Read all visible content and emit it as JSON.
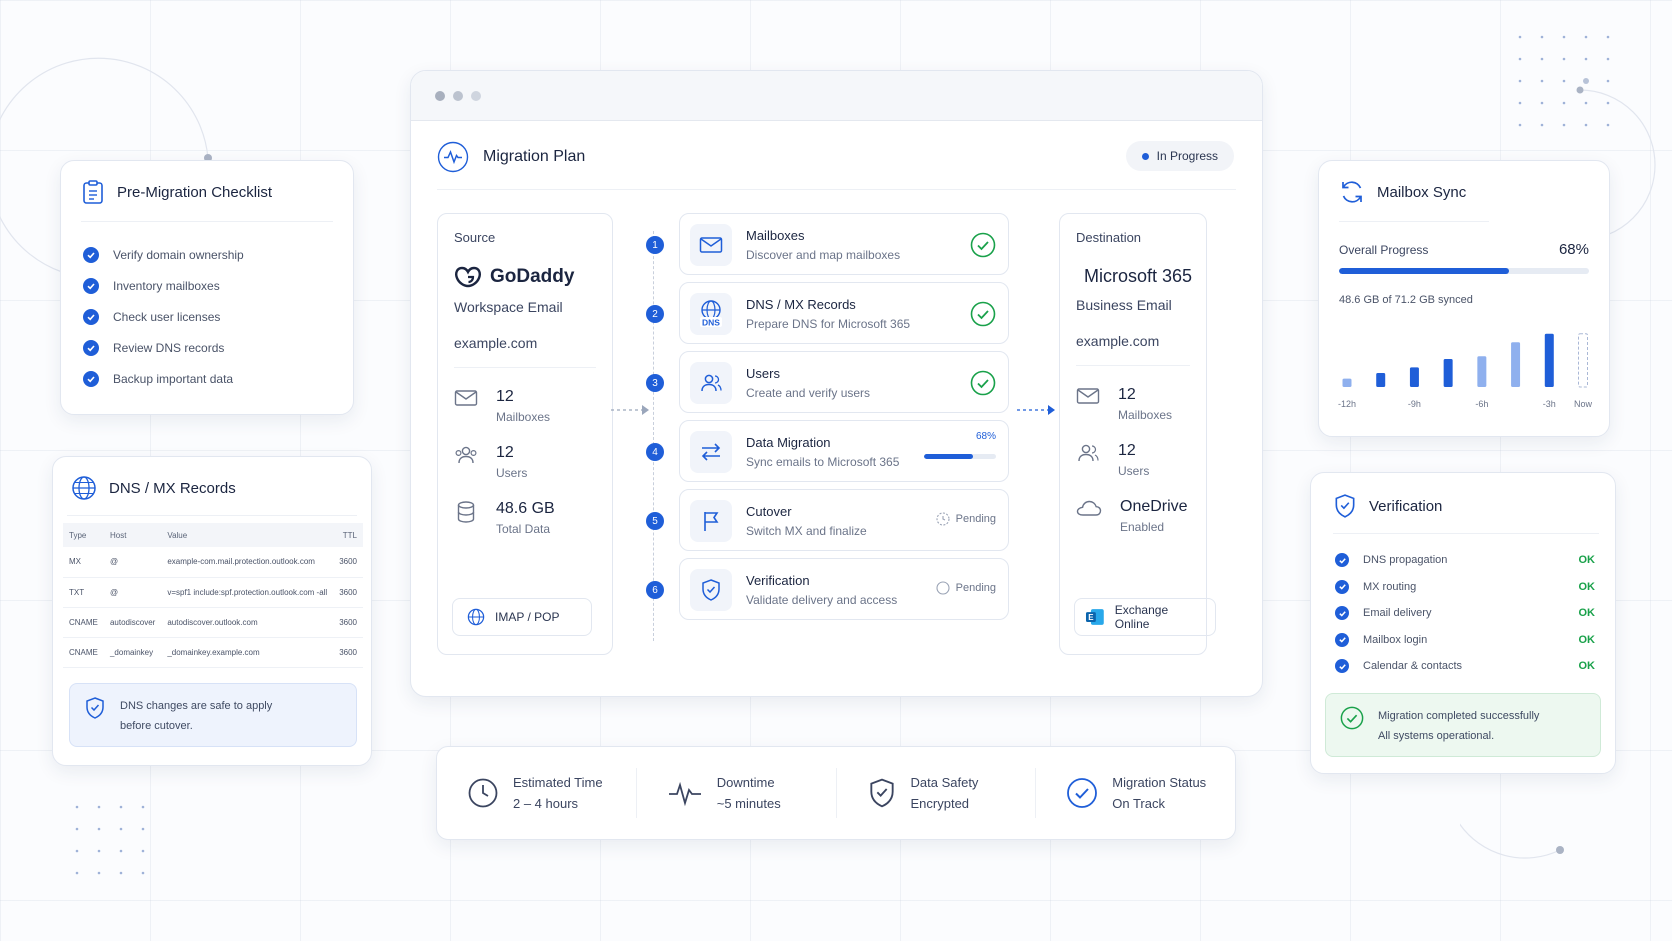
{
  "checklist": {
    "title": "Pre-Migration Checklist",
    "items": [
      "Verify domain ownership",
      "Inventory mailboxes",
      "Check user licenses",
      "Review DNS records",
      "Backup important data"
    ]
  },
  "dns": {
    "title": "DNS / MX Records",
    "columns": [
      "Type",
      "Host",
      "Value",
      "TTL"
    ],
    "rows": [
      [
        "MX",
        "@",
        "example-com.mail.protection.outlook.com",
        "3600"
      ],
      [
        "TXT",
        "@",
        "v=spf1 include:spf.protection.outlook.com -all",
        "3600"
      ],
      [
        "CNAME",
        "autodiscover",
        "autodiscover.outlook.com",
        "3600"
      ],
      [
        "CNAME",
        "_domainkey",
        "_domainkey.example.com",
        "3600"
      ]
    ],
    "note_line1": "DNS changes are safe to apply",
    "note_line2": "before cutover."
  },
  "plan": {
    "title": "Migration Plan",
    "status": "In Progress",
    "source": {
      "label": "Source",
      "brand": "GoDaddy",
      "product": "Workspace Email",
      "domain": "example.com",
      "stats": [
        {
          "value": "12",
          "caption": "Mailboxes"
        },
        {
          "value": "12",
          "caption": "Users"
        },
        {
          "value": "48.6 GB",
          "caption": "Total Data"
        }
      ],
      "protocol": "IMAP / POP"
    },
    "destination": {
      "label": "Destination",
      "brand": "Microsoft 365",
      "product": "Business Email",
      "domain": "example.com",
      "stats": [
        {
          "value": "12",
          "caption": "Mailboxes"
        },
        {
          "value": "12",
          "caption": "Users"
        },
        {
          "value": "OneDrive",
          "caption": "Enabled"
        }
      ],
      "service": "Exchange Online"
    },
    "steps": [
      {
        "n": "1",
        "title": "Mailboxes",
        "desc": "Discover and map mailboxes",
        "state": "done"
      },
      {
        "n": "2",
        "title": "DNS / MX Records",
        "desc": "Prepare DNS for Microsoft 365",
        "state": "done"
      },
      {
        "n": "3",
        "title": "Users",
        "desc": "Create and verify users",
        "state": "done"
      },
      {
        "n": "4",
        "title": "Data Migration",
        "desc": "Sync emails to Microsoft 365",
        "state": "progress",
        "progress_label": "68%",
        "progress": 0.68
      },
      {
        "n": "5",
        "title": "Cutover",
        "desc": "Switch MX and finalize",
        "state": "pending",
        "state_label": "Pending"
      },
      {
        "n": "6",
        "title": "Verification",
        "desc": "Validate delivery and access",
        "state": "pending",
        "state_label": "Pending"
      }
    ],
    "dns_icon_text": "DNS"
  },
  "summary": [
    {
      "label": "Estimated Time",
      "value": "2 – 4 hours"
    },
    {
      "label": "Downtime",
      "value": "~5 minutes"
    },
    {
      "label": "Data Safety",
      "value": "Encrypted"
    },
    {
      "label": "Migration Status",
      "value": "On Track"
    }
  ],
  "sync": {
    "title": "Mailbox Sync",
    "progress_label": "Overall Progress",
    "progress_pct": "68%",
    "progress": 0.68,
    "synced": "48.6 GB of 71.2 GB synced",
    "chart_data": {
      "type": "bar",
      "categories": [
        "-12h",
        "-9h",
        "-6h",
        "-3h",
        "Now"
      ],
      "x_ticks": [
        "-12h",
        "-9h",
        "-6h",
        "-3h",
        "Now"
      ],
      "values": [
        0.15,
        0.25,
        0.35,
        0.5,
        0.55,
        0.8,
        0.95,
        0.95
      ],
      "colors": {
        "filled": "#1f5ed8",
        "light": "#8fb0ee",
        "pending": "#aab8d6"
      }
    }
  },
  "verification": {
    "title": "Verification",
    "items": [
      {
        "label": "DNS propagation",
        "status": "OK"
      },
      {
        "label": "MX routing",
        "status": "OK"
      },
      {
        "label": "Email delivery",
        "status": "OK"
      },
      {
        "label": "Mailbox login",
        "status": "OK"
      },
      {
        "label": "Calendar & contacts",
        "status": "OK"
      }
    ],
    "done_line1": "Migration completed successfully",
    "done_line2": "All systems operational."
  },
  "colors": {
    "accent": "#1f5ed8",
    "success": "#19a14a"
  }
}
